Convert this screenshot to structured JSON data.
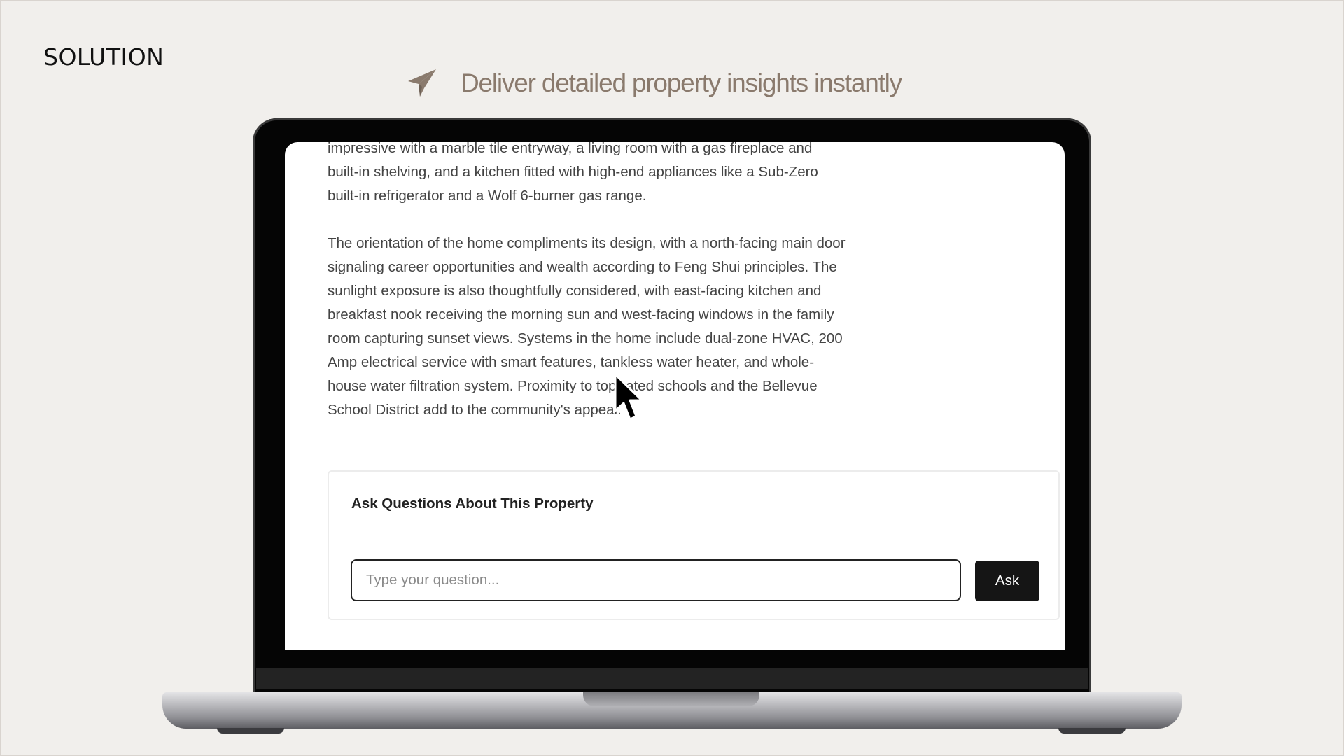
{
  "slide": {
    "section_label": "SOLUTION",
    "headline": "Deliver detailed property insights instantly",
    "headline_icon": "paper-plane-icon",
    "accent_color": "#8a7a6d"
  },
  "property": {
    "paragraphs": [
      "impressive with a marble tile entryway, a living room with a gas fireplace and built-in shelving, and a kitchen fitted with high-end appliances like a Sub-Zero built-in refrigerator and a Wolf 6-burner gas range.",
      "The orientation of the home compliments its design, with a north-facing main door signaling career opportunities and wealth according to Feng Shui principles. The sunlight exposure is also thoughtfully considered, with east-facing kitchen and breakfast nook receiving the morning sun and west-facing windows in the family room capturing sunset views. Systems in the home include dual-zone HVAC, 200 Amp electrical service with smart features, tankless water heater, and whole-house water filtration system. Proximity to top-rated schools and the Bellevue School District add to the community's appeal."
    ]
  },
  "qa": {
    "title": "Ask Questions About This Property",
    "input_placeholder": "Type your question...",
    "input_value": "",
    "ask_label": "Ask"
  }
}
